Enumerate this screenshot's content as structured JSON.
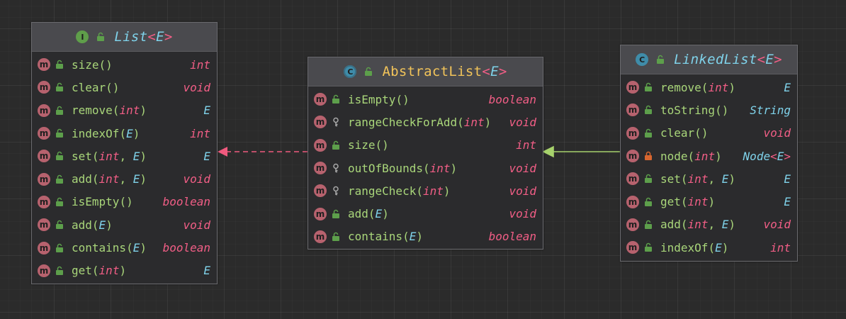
{
  "colors": {
    "method_name": "#a9d67a",
    "param_type": "#f25e86",
    "type_param": "#7fd2ea",
    "public": "#5d9f4b",
    "private": "#d8662f",
    "package_private": "#a8a8a8",
    "method_icon": "#b7626e",
    "interface_icon": "#5f9e4a",
    "class_icon": "#3f8ca9",
    "implements_edge": "#f05a7e",
    "extends_edge": "#a7d26c"
  },
  "classes": [
    {
      "id": "list",
      "kind_letter": "I",
      "kind_icon": "interface-icon",
      "name": "List",
      "type_param": "E",
      "name_color": "#7fd2ea",
      "italic": true,
      "members": [
        {
          "name": "size",
          "params": [],
          "ret": "int",
          "vis": "public"
        },
        {
          "name": "clear",
          "params": [],
          "ret": "void",
          "vis": "public"
        },
        {
          "name": "remove",
          "params": [
            "int"
          ],
          "ret": "E",
          "vis": "public"
        },
        {
          "name": "indexOf",
          "params": [
            "E"
          ],
          "ret": "int",
          "vis": "public"
        },
        {
          "name": "set",
          "params": [
            "int",
            "E"
          ],
          "ret": "E",
          "vis": "public"
        },
        {
          "name": "add",
          "params": [
            "int",
            "E"
          ],
          "ret": "void",
          "vis": "public"
        },
        {
          "name": "isEmpty",
          "params": [],
          "ret": "boolean",
          "vis": "public"
        },
        {
          "name": "add",
          "params": [
            "E"
          ],
          "ret": "void",
          "vis": "public"
        },
        {
          "name": "contains",
          "params": [
            "E"
          ],
          "ret": "boolean",
          "vis": "public"
        },
        {
          "name": "get",
          "params": [
            "int"
          ],
          "ret": "E",
          "vis": "public"
        }
      ]
    },
    {
      "id": "abstractlist",
      "kind_letter": "C",
      "kind_icon": "abstract-class-icon",
      "name": "AbstractList",
      "type_param": "E",
      "name_color": "#f2c45a",
      "italic": false,
      "members": [
        {
          "name": "isEmpty",
          "params": [],
          "ret": "boolean",
          "vis": "public"
        },
        {
          "name": "rangeCheckForAdd",
          "params": [
            "int"
          ],
          "ret": "void",
          "vis": "package"
        },
        {
          "name": "size",
          "params": [],
          "ret": "int",
          "vis": "public"
        },
        {
          "name": "outOfBounds",
          "params": [
            "int"
          ],
          "ret": "void",
          "vis": "package"
        },
        {
          "name": "rangeCheck",
          "params": [
            "int"
          ],
          "ret": "void",
          "vis": "package"
        },
        {
          "name": "add",
          "params": [
            "E"
          ],
          "ret": "void",
          "vis": "public"
        },
        {
          "name": "contains",
          "params": [
            "E"
          ],
          "ret": "boolean",
          "vis": "public"
        }
      ]
    },
    {
      "id": "linkedlist",
      "kind_letter": "C",
      "kind_icon": "class-icon",
      "name": "LinkedList",
      "type_param": "E",
      "name_color": "#7fd2ea",
      "italic": true,
      "members": [
        {
          "name": "remove",
          "params": [
            "int"
          ],
          "ret": "E",
          "vis": "public"
        },
        {
          "name": "toString",
          "params": [],
          "ret": "String",
          "vis": "public"
        },
        {
          "name": "clear",
          "params": [],
          "ret": "void",
          "vis": "public"
        },
        {
          "name": "node",
          "params": [
            "int"
          ],
          "ret": "Node<E>",
          "vis": "private"
        },
        {
          "name": "set",
          "params": [
            "int",
            "E"
          ],
          "ret": "E",
          "vis": "public"
        },
        {
          "name": "get",
          "params": [
            "int"
          ],
          "ret": "E",
          "vis": "public"
        },
        {
          "name": "add",
          "params": [
            "int",
            "E"
          ],
          "ret": "void",
          "vis": "public"
        },
        {
          "name": "indexOf",
          "params": [
            "E"
          ],
          "ret": "int",
          "vis": "public"
        }
      ]
    }
  ],
  "edges": [
    {
      "from": "abstractlist",
      "to": "list",
      "type": "implements",
      "style": "dashed"
    },
    {
      "from": "linkedlist",
      "to": "abstractlist",
      "type": "extends",
      "style": "solid"
    }
  ]
}
